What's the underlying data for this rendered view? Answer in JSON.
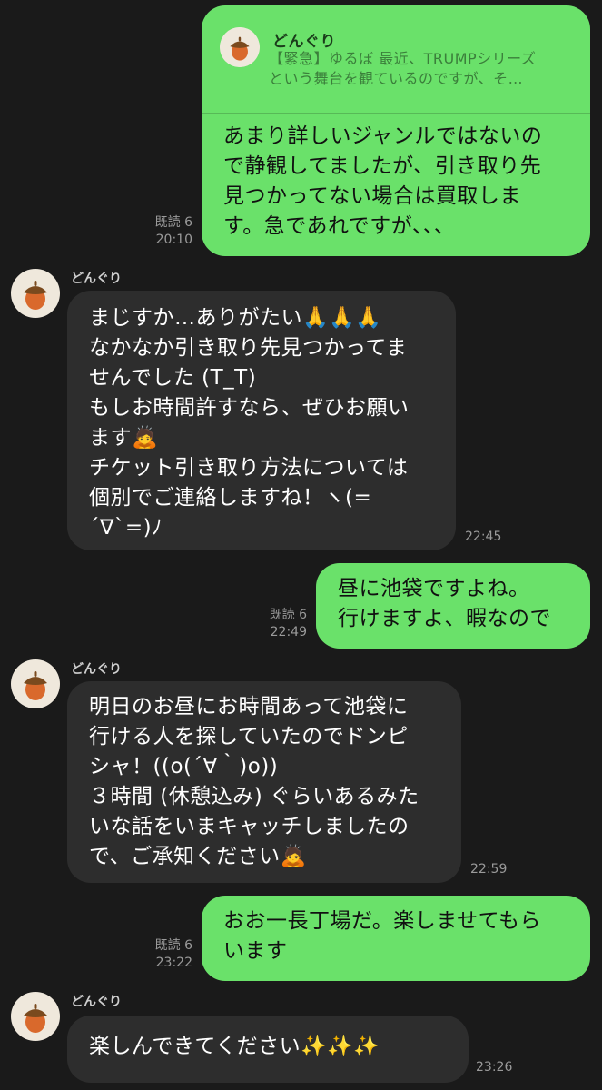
{
  "messages": {
    "m1": {
      "reply_to": {
        "name": "どんぐり",
        "quote_line1": "【緊急】ゆるぼ 最近、TRUMPシリーズ",
        "quote_line2": "という舞台を観ているのですが、そ…"
      },
      "lines": [
        "あまり詳しいジャンルではないの",
        "で静観してましたが、引き取り先",
        "見つかってない場合は買取しま",
        "す。急であれですが、、、"
      ],
      "read": "既読 6",
      "time": "20:10"
    },
    "m2": {
      "sender": "どんぐり",
      "lines": [
        "まじすか…ありがたい🙏🙏🙏",
        "なかなか引き取り先見つかってま",
        "せんでした (T_T)",
        "もしお時間許すなら、ぜひお願い",
        "ます🙇",
        "チケット引き取り方法については",
        "個別でご連絡しますね！ヽ(=",
        "´∇`=)ﾉ"
      ],
      "time": "22:45"
    },
    "m3": {
      "lines": [
        "昼に池袋ですよね。",
        "行けますよ、暇なので"
      ],
      "read": "既読 6",
      "time": "22:49"
    },
    "m4": {
      "sender": "どんぐり",
      "lines": [
        "明日のお昼にお時間あって池袋に",
        "行ける人を探していたのでドンピ",
        "シャ！((o(´∀｀)o))",
        "３時間 (休憩込み) ぐらいあるみた",
        "いな話をいまキャッチしましたの",
        "で、ご承知ください🙇"
      ],
      "time": "22:59"
    },
    "m5": {
      "lines": [
        "おお一長丁場だ。楽しませてもら",
        "います"
      ],
      "read": "既読 6",
      "time": "23:22"
    },
    "m6": {
      "sender": "どんぐり",
      "lines": [
        "楽しんできてください✨✨✨"
      ],
      "time": "23:26"
    }
  },
  "colors": {
    "background": "#1a1a1a",
    "outgoing_bubble": "#6ae16a",
    "incoming_bubble": "#2d2d2d",
    "acorn_cap": "#7a4a1e",
    "acorn_body": "#d9692c"
  },
  "icons": {
    "avatar": "acorn-icon"
  }
}
